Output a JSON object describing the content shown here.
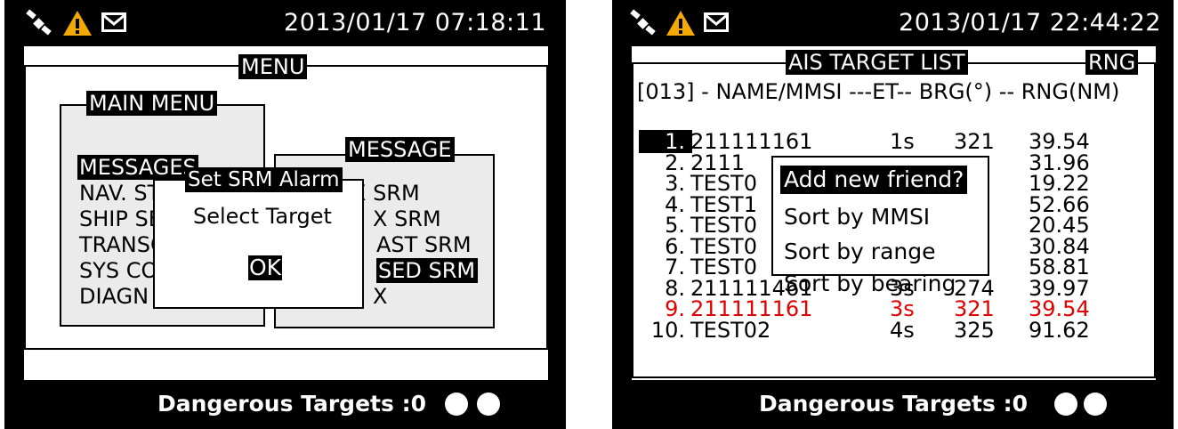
{
  "left_screen": {
    "datetime": "2013/01/17 07:18:11",
    "icons": [
      "satellite-icon",
      "warning-icon",
      "envelope-icon"
    ],
    "menu_title": "MENU",
    "main_menu": {
      "title": "MAIN MENU",
      "items": [
        "MESSAGES",
        "NAV. STAT",
        "SHIP SE",
        "TRANSC",
        "SYS CO",
        "DIAGN"
      ],
      "selected": "MESSAGES"
    },
    "message_menu": {
      "title": "MESSAGE",
      "items": [
        "X SRM",
        "X SRM",
        "AST SRM",
        "SED SRM",
        "X"
      ],
      "selected": "SED SRM"
    },
    "dialog": {
      "title": "Set SRM Alarm",
      "message": "Select Target",
      "ok_label": "OK"
    },
    "dangerous_targets": "Dangerous Targets :0"
  },
  "right_screen": {
    "datetime": "2013/01/17 22:44:22",
    "icons": [
      "satellite-icon",
      "warning-icon",
      "envelope-icon"
    ],
    "list_title": "AIS TARGET LIST",
    "sort_label": "RNG",
    "column_header": "[013] - NAME/MMSI ---ET-- BRG(°) -- RNG(NM)",
    "rows": [
      {
        "num": "1.",
        "name": "211111161",
        "et": "1s",
        "brg": "321",
        "rng": "39.54",
        "highlight": false
      },
      {
        "num": "2.",
        "name": "2111",
        "et": "",
        "brg": "",
        "rng": "31.96",
        "highlight": false
      },
      {
        "num": "3.",
        "name": "TEST0",
        "et": "",
        "brg": "",
        "rng": "19.22",
        "highlight": false
      },
      {
        "num": "4.",
        "name": "TEST1",
        "et": "",
        "brg": "",
        "rng": "52.66",
        "highlight": false
      },
      {
        "num": "5.",
        "name": "TEST0",
        "et": "",
        "brg": "",
        "rng": "20.45",
        "highlight": false
      },
      {
        "num": "6.",
        "name": "TEST0",
        "et": "",
        "brg": "",
        "rng": "30.84",
        "highlight": false
      },
      {
        "num": "7.",
        "name": "TEST0",
        "et": "",
        "brg": "",
        "rng": "58.81",
        "highlight": false
      },
      {
        "num": "8.",
        "name": "211111461",
        "et": "3s",
        "brg": "274",
        "rng": "39.97",
        "highlight": false
      },
      {
        "num": "9.",
        "name": "211111161",
        "et": "3s",
        "brg": "321",
        "rng": "39.54",
        "highlight": true
      },
      {
        "num": "10.",
        "name": "TEST02",
        "et": "4s",
        "brg": "325",
        "rng": "91.62",
        "highlight": false
      }
    ],
    "popup_menu": [
      "Add new friend?",
      "Sort by MMSI",
      "Sort by range",
      "Sort by bearing"
    ],
    "popup_selected": "Add new friend?",
    "dangerous_targets": "Dangerous Targets :0"
  },
  "colors": {
    "screen_bg": "#000000",
    "panel_bg": "#ffffff",
    "submenu_bg": "#ebebeb",
    "warning": "#f2a900",
    "highlight_red": "#e00000"
  }
}
